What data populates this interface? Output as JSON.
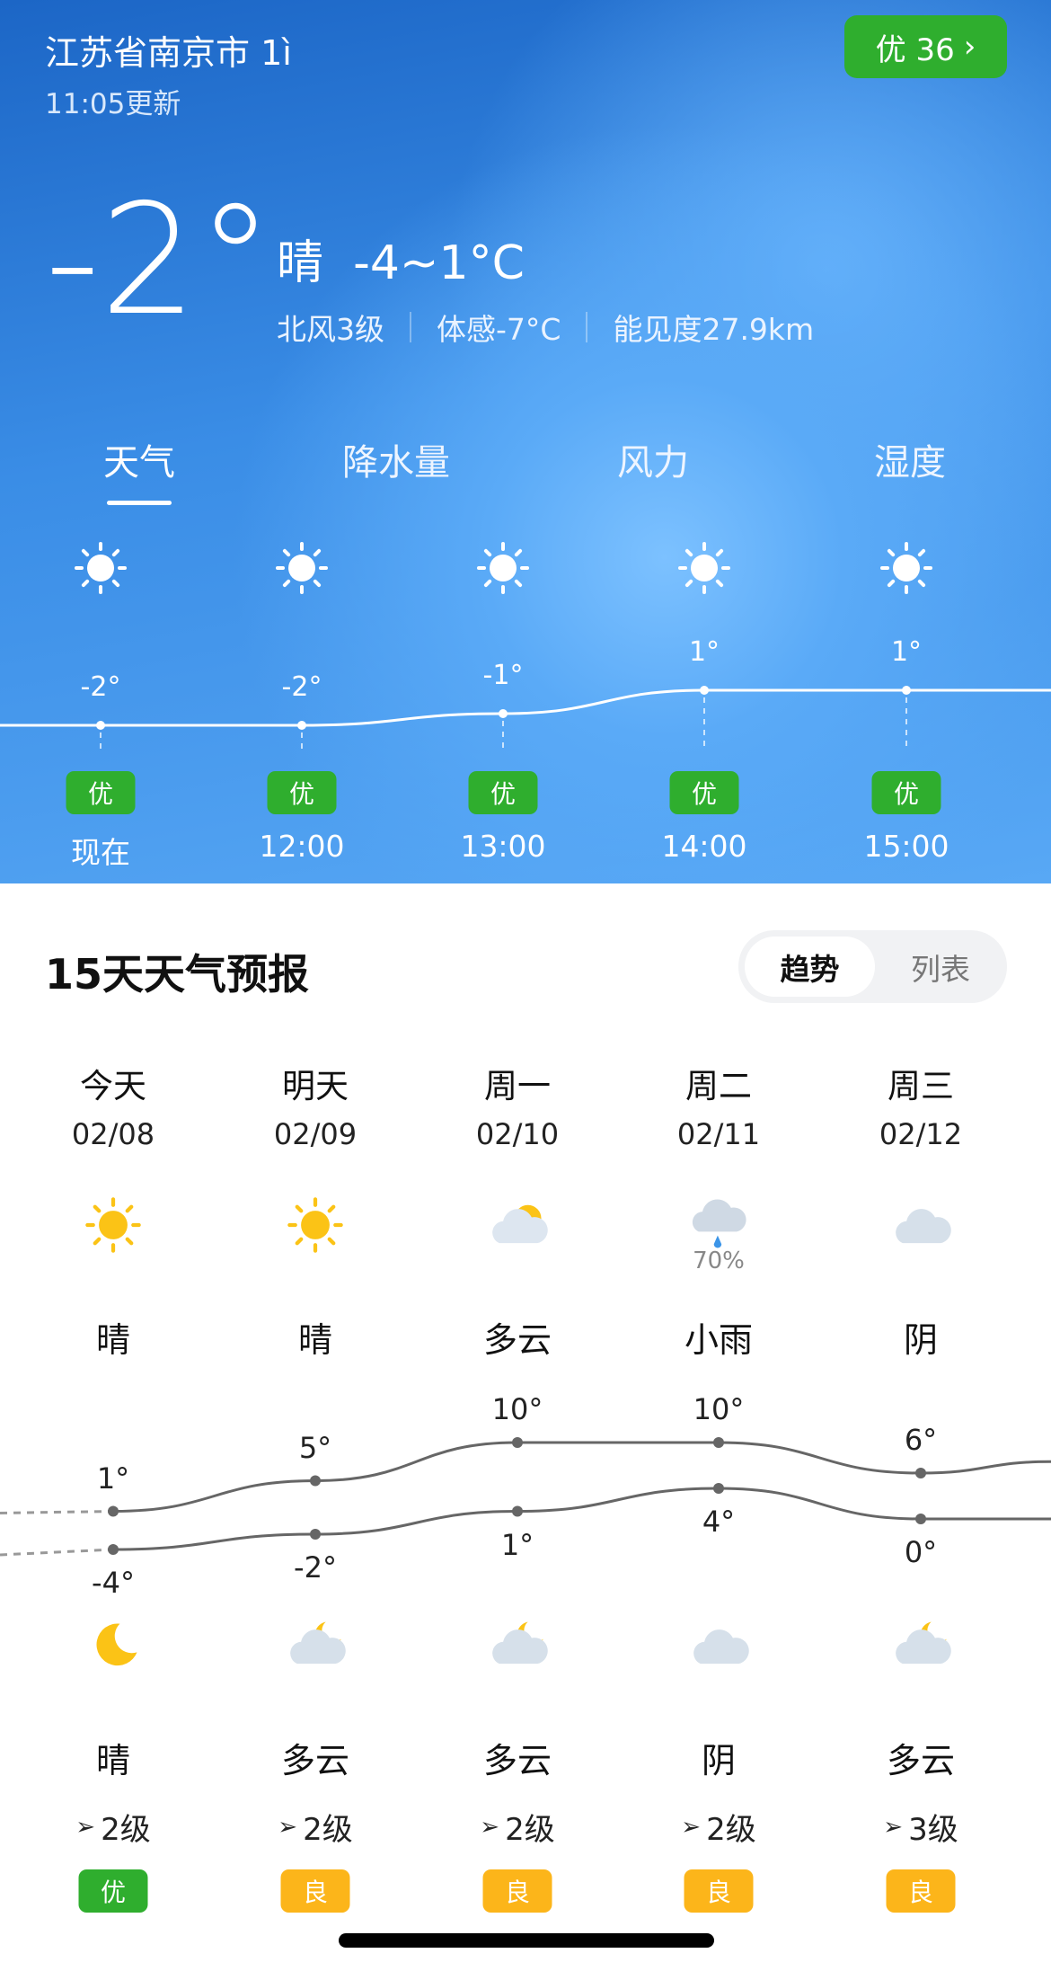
{
  "header": {
    "location": "江苏省南京市 1ì",
    "updated": "11:05更新",
    "aqi_button": {
      "label": "优 36",
      "icon": "chevron-right-icon",
      "color": "#2fae2e"
    }
  },
  "current": {
    "temp": "-2°",
    "condition": "晴",
    "range": "-4~1°C",
    "wind": "北风3级",
    "feels": "体感-7°C",
    "visibility": "能见度27.9km"
  },
  "tabs": [
    {
      "label": "天气",
      "active": true
    },
    {
      "label": "降水量"
    },
    {
      "label": "风力"
    },
    {
      "label": "湿度"
    }
  ],
  "hourly": [
    {
      "time": "现在",
      "temp": "-2°",
      "value": -2,
      "icon": "sun-icon",
      "aqi": "优"
    },
    {
      "time": "12:00",
      "temp": "-2°",
      "value": -2,
      "icon": "sun-icon",
      "aqi": "优"
    },
    {
      "time": "13:00",
      "temp": "-1°",
      "value": -1,
      "icon": "sun-icon",
      "aqi": "优"
    },
    {
      "time": "14:00",
      "temp": "1°",
      "value": 1,
      "icon": "sun-icon",
      "aqi": "优"
    },
    {
      "time": "15:00",
      "temp": "1°",
      "value": 1,
      "icon": "sun-icon",
      "aqi": "优"
    }
  ],
  "forecast": {
    "title": "15天天气预报",
    "toggle": [
      "趋势",
      "列表"
    ],
    "days": [
      {
        "day": "今天",
        "date": "02/08",
        "day_icon": "sun-icon",
        "day_desc": "晴",
        "high": "1°",
        "high_v": 1,
        "low": "-4°",
        "low_v": -4,
        "night_icon": "moon-icon",
        "night_desc": "晴",
        "wind": "2级",
        "aqi": "优",
        "aqi_color": "#2fae2e"
      },
      {
        "day": "明天",
        "date": "02/09",
        "day_icon": "sun-icon",
        "day_desc": "晴",
        "high": "5°",
        "high_v": 5,
        "low": "-2°",
        "low_v": -2,
        "night_icon": "moon-cloud-icon",
        "night_desc": "多云",
        "wind": "2级",
        "aqi": "良",
        "aqi_color": "#fcb51a"
      },
      {
        "day": "周一",
        "date": "02/10",
        "day_icon": "sun-cloud-icon",
        "day_desc": "多云",
        "high": "10°",
        "high_v": 10,
        "low": "1°",
        "low_v": 1,
        "night_icon": "moon-cloud-icon",
        "night_desc": "多云",
        "wind": "2级",
        "aqi": "良",
        "aqi_color": "#fcb51a"
      },
      {
        "day": "周二",
        "date": "02/11",
        "day_icon": "rain-cloud-icon",
        "precip": "70%",
        "day_desc": "小雨",
        "high": "10°",
        "high_v": 10,
        "low": "4°",
        "low_v": 4,
        "night_icon": "cloud-icon",
        "night_desc": "阴",
        "wind": "2级",
        "aqi": "良",
        "aqi_color": "#fcb51a"
      },
      {
        "day": "周三",
        "date": "02/12",
        "day_icon": "cloud-icon",
        "day_desc": "阴",
        "high": "6°",
        "high_v": 6,
        "low": "0°",
        "low_v": 0,
        "night_icon": "moon-cloud-icon",
        "night_desc": "多云",
        "wind": "3级",
        "aqi": "良",
        "aqi_color": "#fcb51a"
      }
    ]
  }
}
